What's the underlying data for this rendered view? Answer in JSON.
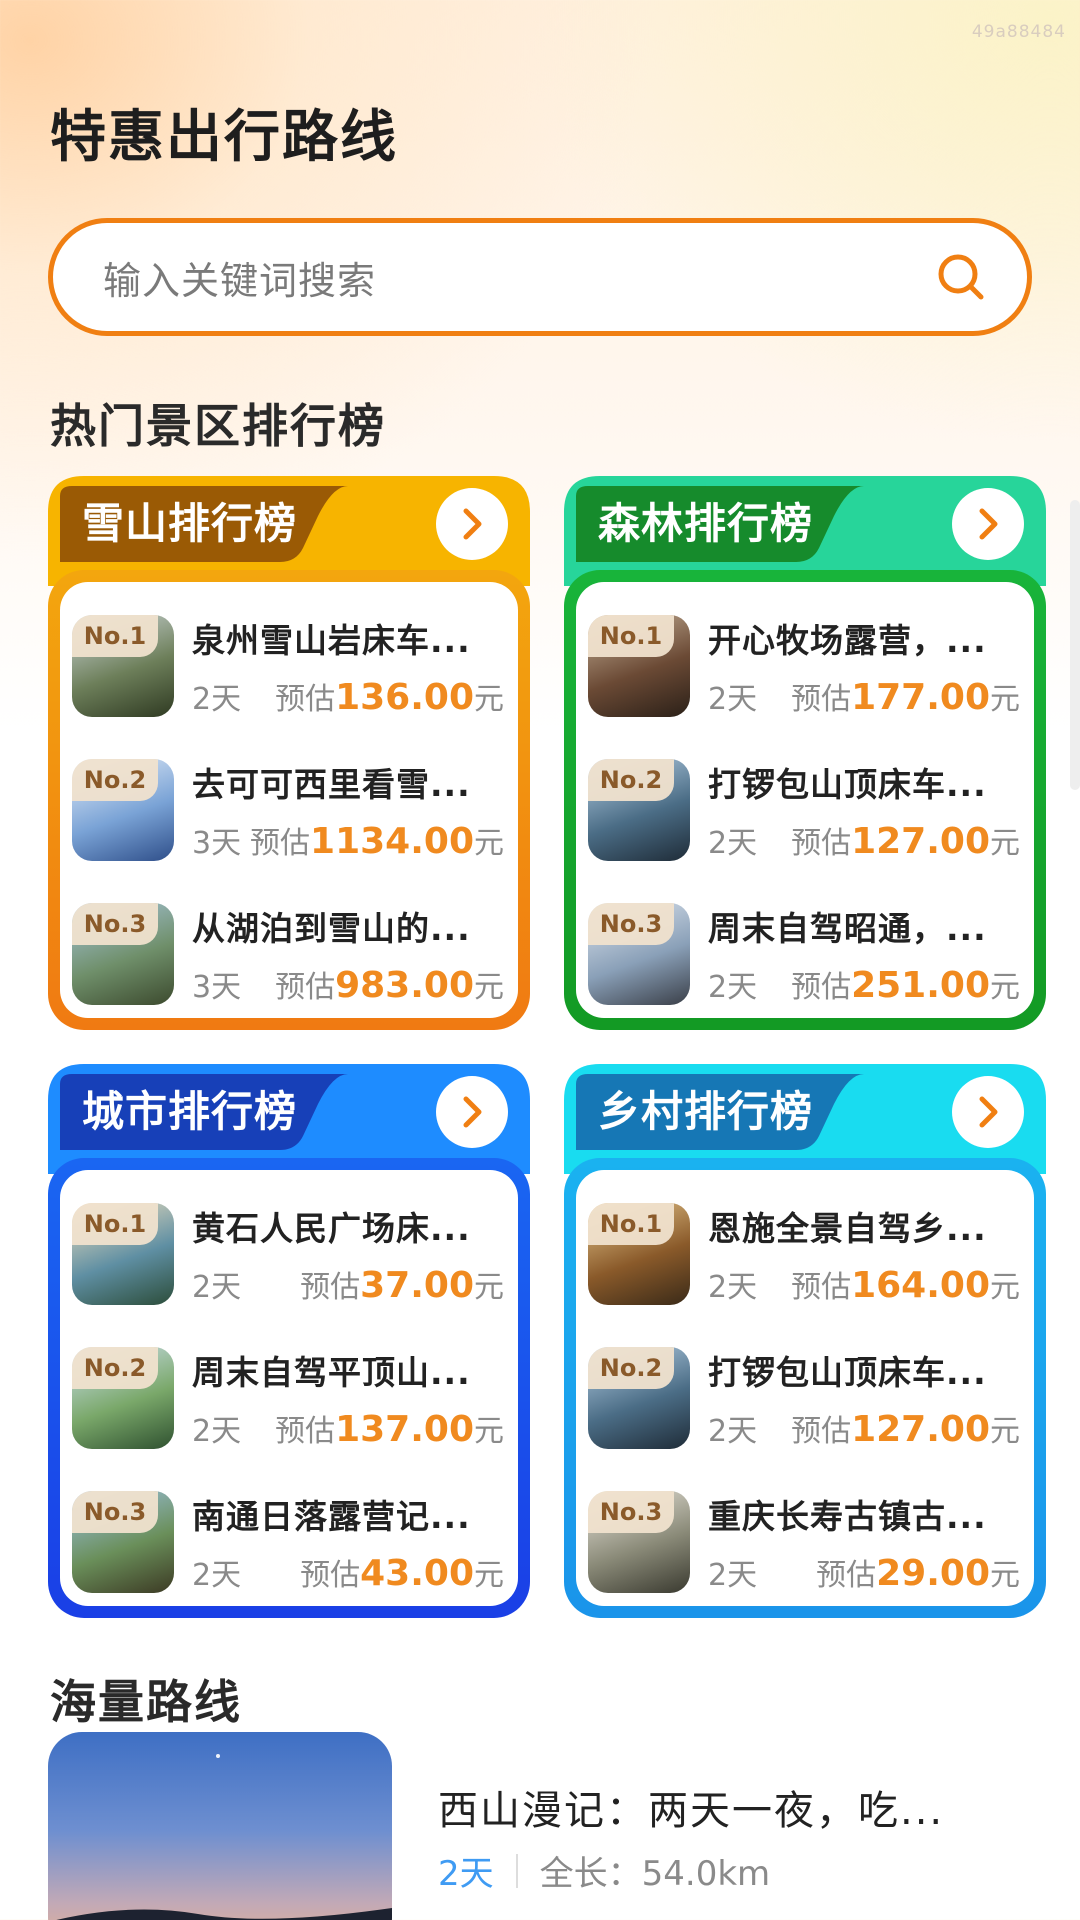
{
  "watermark": "49a88484",
  "page_title": "特惠出行路线",
  "search": {
    "placeholder": "输入关键词搜索"
  },
  "hot_section_title": "热门景区排行榜",
  "ranking_cards": [
    {
      "title": "雪山排行榜",
      "colors": {
        "tab_dark": "#9a5a05",
        "tab_light": "#f7b400",
        "frame_top": "#f3a60e",
        "frame_bottom": "#f07a12"
      },
      "items": [
        {
          "rank": "No.1",
          "title": "泉州雪山岩床车...",
          "days": "2天",
          "price_prefix": "预估",
          "price": "136.00",
          "unit": "元"
        },
        {
          "rank": "No.2",
          "title": "去可可西里看雪...",
          "days": "3天",
          "price_prefix": "预估",
          "price": "1134.00",
          "unit": "元"
        },
        {
          "rank": "No.3",
          "title": "从湖泊到雪山的...",
          "days": "3天",
          "price_prefix": "预估",
          "price": "983.00",
          "unit": "元"
        }
      ]
    },
    {
      "title": "森林排行榜",
      "colors": {
        "tab_dark": "#168b2c",
        "tab_light": "#27d59a",
        "frame_top": "#18b43a",
        "frame_bottom": "#139a24"
      },
      "items": [
        {
          "rank": "No.1",
          "title": "开心牧场露营，...",
          "days": "2天",
          "price_prefix": "预估",
          "price": "177.00",
          "unit": "元"
        },
        {
          "rank": "No.2",
          "title": "打锣包山顶床车...",
          "days": "2天",
          "price_prefix": "预估",
          "price": "127.00",
          "unit": "元"
        },
        {
          "rank": "No.3",
          "title": "周末自驾昭通，...",
          "days": "2天",
          "price_prefix": "预估",
          "price": "251.00",
          "unit": "元"
        }
      ]
    },
    {
      "title": "城市排行榜",
      "colors": {
        "tab_dark": "#1740b8",
        "tab_light": "#1e8cff",
        "frame_top": "#1a66f2",
        "frame_bottom": "#1a3fe6"
      },
      "items": [
        {
          "rank": "No.1",
          "title": "黄石人民广场床...",
          "days": "2天",
          "price_prefix": "预估",
          "price": "37.00",
          "unit": "元"
        },
        {
          "rank": "No.2",
          "title": "周末自驾平顶山...",
          "days": "2天",
          "price_prefix": "预估",
          "price": "137.00",
          "unit": "元"
        },
        {
          "rank": "No.3",
          "title": "南通日落露营记...",
          "days": "2天",
          "price_prefix": "预估",
          "price": "43.00",
          "unit": "元"
        }
      ]
    },
    {
      "title": "乡村排行榜",
      "colors": {
        "tab_dark": "#1677b5",
        "tab_light": "#19dcf0",
        "frame_top": "#1ab2f0",
        "frame_bottom": "#1a94ea"
      },
      "items": [
        {
          "rank": "No.1",
          "title": "恩施全景自驾乡...",
          "days": "2天",
          "price_prefix": "预估",
          "price": "164.00",
          "unit": "元"
        },
        {
          "rank": "No.2",
          "title": "打锣包山顶床车...",
          "days": "2天",
          "price_prefix": "预估",
          "price": "127.00",
          "unit": "元"
        },
        {
          "rank": "No.3",
          "title": "重庆长寿古镇古...",
          "days": "2天",
          "price_prefix": "预估",
          "price": "29.00",
          "unit": "元"
        }
      ]
    }
  ],
  "routes_section_title": "海量路线",
  "route": {
    "title": "西山漫记：两天一夜，吃...",
    "days": "2天",
    "length": "全长：54.0km"
  },
  "accent": {
    "orange": "#f07f12",
    "price": "#f08a1f",
    "blue": "#3f9bf3"
  },
  "icons": {
    "search": "search-icon",
    "arrow": "chevron-right-icon"
  }
}
